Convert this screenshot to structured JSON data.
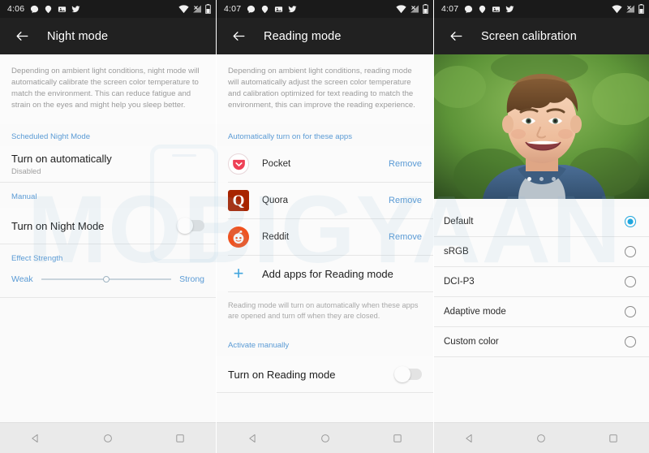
{
  "screens": [
    {
      "id": "night-mode",
      "statusbar": {
        "time": "4:06",
        "left_icons": [
          "chat-icon",
          "navigation-icon",
          "photo-icon",
          "twitter-icon"
        ],
        "right_icons": [
          "wifi-icon",
          "no-sim-signal-icon",
          "battery-icon"
        ]
      },
      "appbar": {
        "back": "back-arrow-icon",
        "title": "Night mode"
      },
      "description": "Depending on ambient light conditions, night mode will automatically calibrate the screen color temperature to match the environment. This can reduce fatigue and strain on the eyes and might help you sleep better.",
      "section_scheduled": "Scheduled Night Mode",
      "auto_row": {
        "title": "Turn on automatically",
        "subtitle": "Disabled"
      },
      "section_manual": "Manual",
      "manual_row": {
        "title": "Turn on Night Mode",
        "toggle_state": "off"
      },
      "section_effect": "Effect Strength",
      "slider": {
        "min_label": "Weak",
        "max_label": "Strong",
        "value_percent": 50
      }
    },
    {
      "id": "reading-mode",
      "statusbar": {
        "time": "4:07",
        "left_icons": [
          "chat-icon",
          "navigation-icon",
          "photo-icon",
          "twitter-icon"
        ],
        "right_icons": [
          "wifi-icon",
          "no-sim-signal-icon",
          "battery-icon"
        ]
      },
      "appbar": {
        "back": "back-arrow-icon",
        "title": "Reading mode"
      },
      "description": "Depending on ambient light conditions, reading mode will automatically adjust the screen color temperature and calibration optimized for text reading to match the environment, this can improve the reading experience.",
      "section_auto": "Automatically turn on for these apps",
      "apps": [
        {
          "name": "Pocket",
          "icon": "pocket-icon",
          "action": "Remove"
        },
        {
          "name": "Quora",
          "icon": "quora-icon",
          "action": "Remove"
        },
        {
          "name": "Reddit",
          "icon": "reddit-icon",
          "action": "Remove"
        }
      ],
      "add_apps": {
        "icon": "plus-icon",
        "label": "Add apps for Reading mode"
      },
      "hint": "Reading mode will turn on automatically when these apps are opened and turn off when they are closed.",
      "section_manual": "Activate manually",
      "manual_row": {
        "title": "Turn on Reading mode",
        "toggle_state": "off"
      }
    },
    {
      "id": "screen-calibration",
      "statusbar": {
        "time": "4:07",
        "left_icons": [
          "chat-icon",
          "navigation-icon",
          "photo-icon",
          "twitter-icon"
        ],
        "right_icons": [
          "wifi-icon",
          "no-sim-signal-icon",
          "battery-icon"
        ]
      },
      "appbar": {
        "back": "back-arrow-icon",
        "title": "Screen calibration"
      },
      "preview": {
        "alt": "smiling-boy-photo",
        "page_dots": 3,
        "active_dot": 1
      },
      "options": [
        {
          "label": "Default",
          "selected": true
        },
        {
          "label": "sRGB",
          "selected": false
        },
        {
          "label": "DCI-P3",
          "selected": false
        },
        {
          "label": "Adaptive mode",
          "selected": false
        },
        {
          "label": "Custom color",
          "selected": false
        }
      ]
    }
  ],
  "navbar": {
    "back": "back-triangle-icon",
    "home": "home-circle-icon",
    "recents": "recents-square-icon"
  },
  "watermark": {
    "text": "MOBIGYAAN"
  },
  "colors": {
    "accent_blue": "#5b9bd5",
    "radio_blue": "#1fa6de",
    "statusbar_bg": "#1a1a1a",
    "appbar_bg": "#212121",
    "body_bg": "#fbfbfb",
    "navbar_bg": "#eaeaea",
    "quora_red": "#a82400",
    "reddit_orange": "#f0521f"
  }
}
